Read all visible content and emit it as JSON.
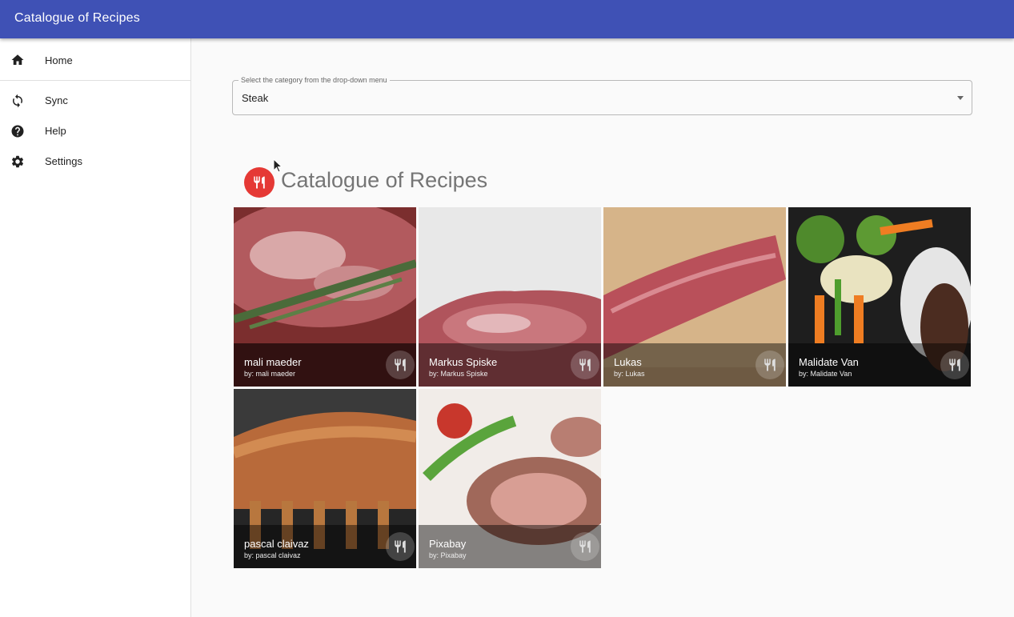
{
  "app": {
    "title": "Catalogue of Recipes"
  },
  "sidebar": {
    "items": [
      {
        "label": "Home",
        "icon": "home-icon"
      },
      {
        "label": "Sync",
        "icon": "sync-icon"
      },
      {
        "label": "Help",
        "icon": "help-icon"
      },
      {
        "label": "Settings",
        "icon": "gear-icon"
      }
    ]
  },
  "category_select": {
    "label": "Select the category from the drop-down menu",
    "value": "Steak"
  },
  "section": {
    "title": "Catalogue of Recipes",
    "icon": "restaurant-icon"
  },
  "recipes": [
    {
      "title": "mali maeder",
      "subtitle": "by: mali maeder"
    },
    {
      "title": "Markus Spiske",
      "subtitle": "by: Markus Spiske"
    },
    {
      "title": "Lukas",
      "subtitle": "by: Lukas"
    },
    {
      "title": "Malidate Van",
      "subtitle": "by: Malidate Van"
    },
    {
      "title": "pascal claivaz",
      "subtitle": "by: pascal claivaz"
    },
    {
      "title": "Pixabay",
      "subtitle": "by: Pixabay"
    }
  ],
  "colors": {
    "app_bar": "#3f51b5",
    "accent": "#e53935"
  }
}
